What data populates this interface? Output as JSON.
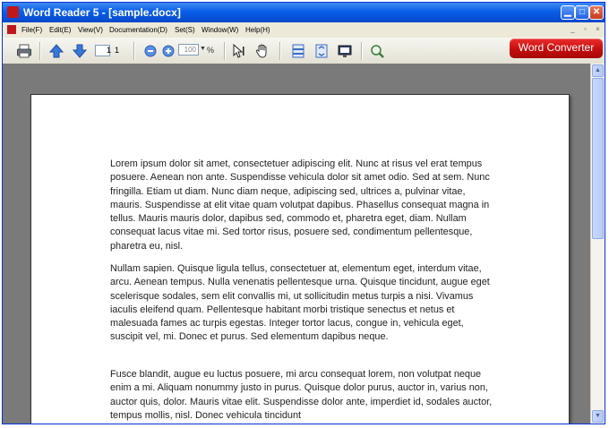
{
  "window": {
    "title": "Word Reader 5 - [sample.docx]"
  },
  "menu": [
    "File(F)",
    "Edit(E)",
    "View(V)",
    "Documentation(D)",
    "Set(S)",
    "Window(W)",
    "Help(H)"
  ],
  "toolbar": {
    "page_current": "1",
    "page_total": "1",
    "zoom_value": "100",
    "zoom_unit": "%",
    "converter_label": "Word Converter"
  },
  "document": {
    "paragraphs": [
      "Lorem ipsum dolor sit amet, consectetuer adipiscing elit. Nunc at risus vel erat tempus posuere. Aenean non ante. Suspendisse vehicula dolor sit amet odio. Sed at sem. Nunc fringilla. Etiam ut diam. Nunc diam neque, adipiscing sed, ultrices a, pulvinar vitae, mauris. Suspendisse at elit vitae quam volutpat dapibus. Phasellus consequat magna in tellus. Mauris mauris dolor, dapibus sed, commodo et, pharetra eget, diam. Nullam consequat lacus vitae mi. Sed tortor risus, posuere sed, condimentum pellentesque, pharetra eu, nisl.",
      "Nullam sapien. Quisque ligula tellus, consectetuer at, elementum eget, interdum vitae, arcu. Aenean tempus. Nulla venenatis pellentesque urna. Quisque tincidunt, augue eget scelerisque sodales, sem elit convallis mi, ut sollicitudin metus turpis a nisi. Vivamus iaculis eleifend quam. Pellentesque habitant morbi tristique senectus et netus et malesuada fames ac turpis egestas. Integer tortor lacus, congue in, vehicula eget, suscipit vel, mi. Donec et purus. Sed elementum dapibus neque.",
      "Fusce blandit, augue eu luctus posuere, mi arcu consequat lorem, non volutpat neque enim a mi. Aliquam nonummy justo in purus. Quisque dolor purus, auctor in, varius non, auctor quis, dolor. Mauris vitae elit. Suspendisse dolor ante, imperdiet id, sodales auctor, tempus mollis, nisl. Donec vehicula tincidunt"
    ]
  },
  "colors": {
    "accent": "#0a5ee8",
    "converter": "#c40d0d",
    "viewport": "#7a7a7a"
  }
}
